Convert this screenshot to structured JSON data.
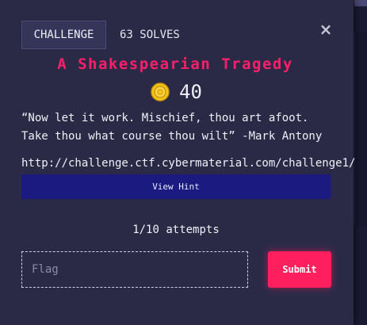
{
  "modal": {
    "category_label": "CHALLENGE",
    "solves_label": "63 SOLVES",
    "close_glyph": "×",
    "title": "A Shakespearian Tragedy",
    "points": "40",
    "description_line1": "“Now let it work. Mischief, thou art afoot.",
    "description_line2": "Take thou what course thou wilt” -Mark Antony",
    "url": "http://challenge.ctf.cybermaterial.com/challenge1/",
    "hint_label": "View Hint",
    "attempts": "1/10 attempts",
    "flag_placeholder": "Flag",
    "submit_label": "Submit"
  },
  "colors": {
    "accent": "#ff1f5e",
    "title": "#ff1f6a",
    "hint_bg": "#1a1a80",
    "modal_bg": "#2a2a47",
    "coin": "#f5c518"
  },
  "icons": {
    "close": "close-icon",
    "coin": "coin-icon"
  }
}
